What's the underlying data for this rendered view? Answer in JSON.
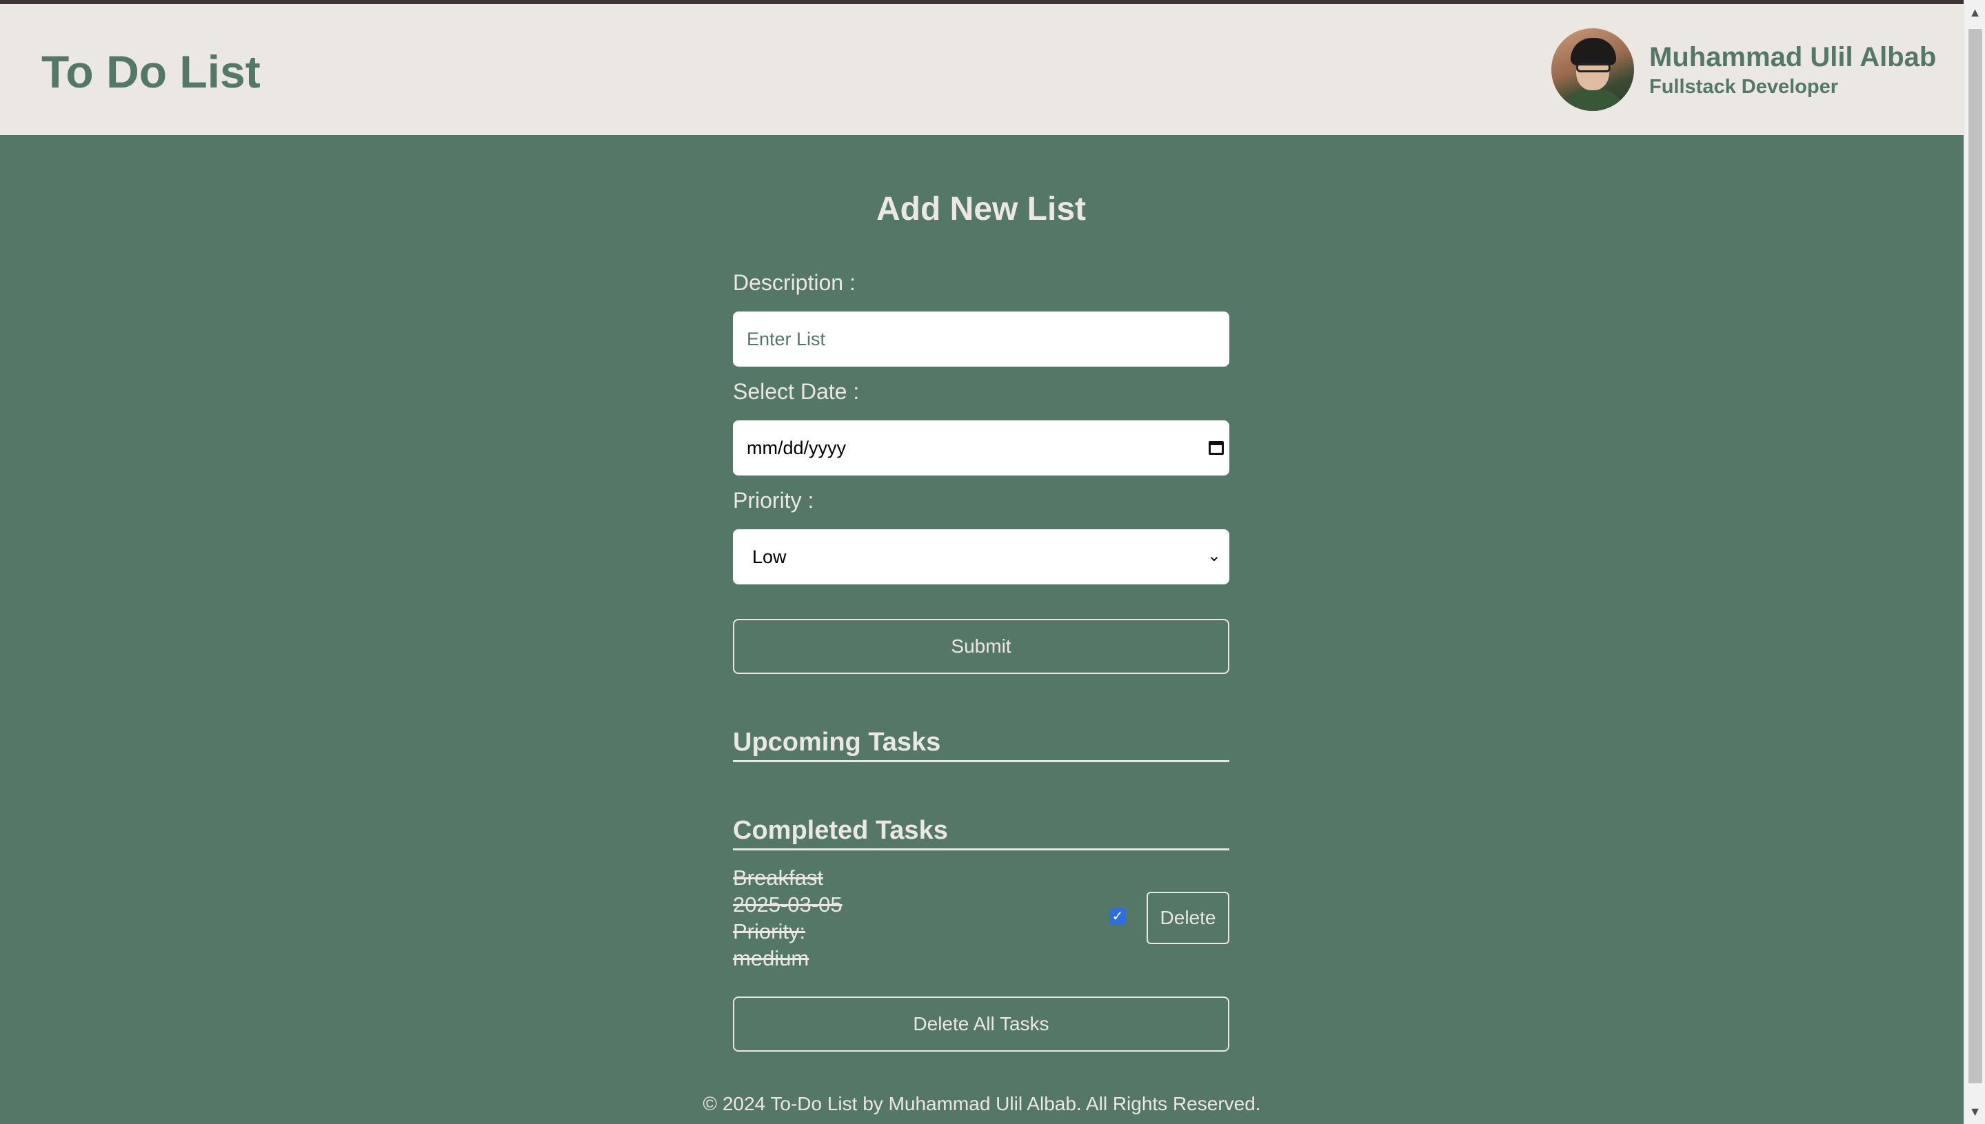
{
  "header": {
    "title": "To Do List",
    "profile": {
      "name": "Muhammad Ulil Albab",
      "role": "Fullstack Developer"
    }
  },
  "form": {
    "title": "Add New List",
    "description_label": "Description :",
    "description_placeholder": "Enter List",
    "date_label": "Select Date :",
    "date_value": "mm/dd/yyyy",
    "priority_label": "Priority :",
    "priority_selected": "Low",
    "submit_label": "Submit"
  },
  "sections": {
    "upcoming_title": "Upcoming Tasks",
    "completed_title": "Completed Tasks"
  },
  "completed_tasks": [
    {
      "description": "Breakfast",
      "date": "2025-03-05",
      "priority_label": "Priority:",
      "priority": "medium",
      "checked": true,
      "delete_label": "Delete"
    }
  ],
  "delete_all_label": "Delete All Tasks",
  "footer": {
    "text": "© 2024 To-Do List by Muhammad Ulil Albab. All Rights Reserved."
  },
  "colors": {
    "background": "#547767",
    "header_bg": "#ebe7e2",
    "accent": "#547767",
    "light_text": "#ebe7e2",
    "checkbox": "#2f6fdb"
  }
}
